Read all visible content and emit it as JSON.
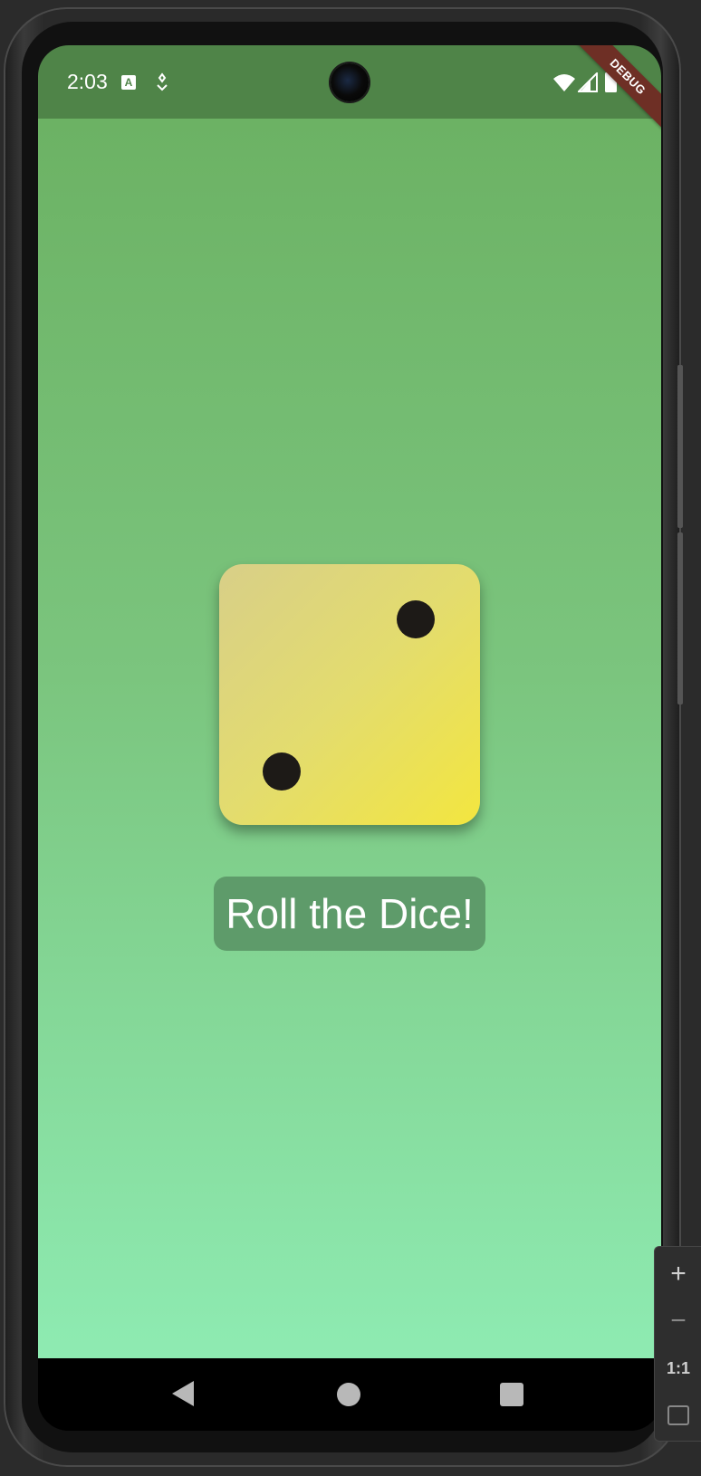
{
  "status_bar": {
    "time": "2:03",
    "icons": [
      "text-a-icon",
      "accessibility-icon",
      "wifi-icon",
      "signal-icon",
      "battery-icon"
    ],
    "background_color": "#4f8448"
  },
  "debug_banner": {
    "label": "DEBUG",
    "color": "#6e2f25"
  },
  "app": {
    "background_gradient": [
      "#6cb264",
      "#8eebb2"
    ],
    "dice": {
      "face_value": 2,
      "gradient": [
        "#d8cf88",
        "#f3e63f"
      ],
      "pip_color": "#1d1a17"
    },
    "roll_button": {
      "label": "Roll the Dice!",
      "background_color": "#5e9b6a"
    }
  },
  "nav_bar": {
    "icons": [
      "back-icon",
      "home-icon",
      "recents-icon"
    ]
  },
  "emulator_zoom": {
    "plus_label": "+",
    "minus_label": "−",
    "reset_label": "1:1",
    "icons": [
      "zoom-in-icon",
      "zoom-out-icon",
      "fit-screen-icon"
    ]
  }
}
